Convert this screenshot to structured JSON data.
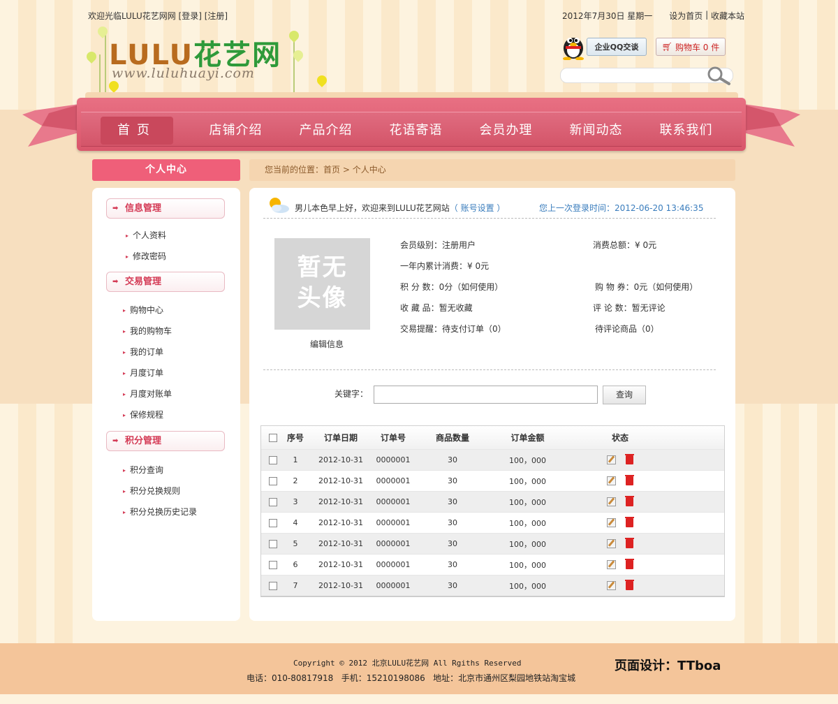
{
  "topbar": {
    "welcome": "欢迎光临LULU花艺网网 [登录] [注册]",
    "date": "2012年7月30日 星期一",
    "set_home": "设为首页",
    "sep": " | ",
    "favorite": "收藏本站"
  },
  "logo": {
    "brand_latin": "LULU",
    "brand_cn": "花艺网",
    "url": "www.luluhuayi.com"
  },
  "header": {
    "qq_label": "企业QQ交谈",
    "cart_label": "购物车 0 件",
    "search_placeholder": ""
  },
  "nav": [
    "首页",
    "店铺介绍",
    "产品介绍",
    "花语寄语",
    "会员办理",
    "新闻动态",
    "联系我们"
  ],
  "sidebar": {
    "title": "个人中心",
    "groups": [
      {
        "label": "信息管理",
        "items": [
          "个人资料",
          "修改密码"
        ]
      },
      {
        "label": "交易管理",
        "items": [
          "购物中心",
          "我的购物车",
          "我的订单",
          "月度订单",
          "月度对账单",
          "保修规程"
        ]
      },
      {
        "label": "积分管理",
        "items": [
          "积分查询",
          "积分兑换规则",
          "积分兑换历史记录"
        ]
      }
    ]
  },
  "breadcrumb": {
    "prefix": "您当前的位置：",
    "home": "首页",
    "sep": " > ",
    "current": "个人中心"
  },
  "profile": {
    "greeting": "男儿本色早上好，欢迎来到LULU花艺网站",
    "account_link": "（ 账号设置 ）",
    "last_login": "您上一次登录时间：2012-06-20 13:46:35",
    "avatar_text_1": "暂无",
    "avatar_text_2": "头像",
    "edit_info": "编辑信息",
    "member_level": "会员级别：注册用户",
    "total_spent": "消费总额：¥ 0元",
    "year_spent": "一年内累计消费：¥ 0元",
    "points": "积 分 数：0分（如何使用）",
    "coupons": "购 物 券：0元（如何使用）",
    "collections": "收 藏 品：暂无收藏",
    "reviews": "评 论 数：暂无评论",
    "trade_reminder": "交易提醒：待支付订单（0）",
    "pending_reviews": "待评论商品（0）"
  },
  "search": {
    "label": "关键字：",
    "value": "",
    "button": "查询"
  },
  "table": {
    "headers": [
      "序号",
      "订单日期",
      "订单号",
      "商品数量",
      "订单金额",
      "状态"
    ],
    "rows": [
      [
        "1",
        "2012-10-31",
        "0000001",
        "30",
        "100，000"
      ],
      [
        "2",
        "2012-10-31",
        "0000001",
        "30",
        "100，000"
      ],
      [
        "3",
        "2012-10-31",
        "0000001",
        "30",
        "100，000"
      ],
      [
        "4",
        "2012-10-31",
        "0000001",
        "30",
        "100，000"
      ],
      [
        "5",
        "2012-10-31",
        "0000001",
        "30",
        "100，000"
      ],
      [
        "6",
        "2012-10-31",
        "0000001",
        "30",
        "100，000"
      ],
      [
        "7",
        "2012-10-31",
        "0000001",
        "30",
        "100，000"
      ]
    ]
  },
  "footer": {
    "copyright": "Copyright © 2012 北京LULU花艺网 All Rgiths Reserved",
    "contact": "电话：010-80817918   手机：15210198086   地址：北京市通州区梨园地铁站淘宝城",
    "design": "页面设计：TTboa"
  },
  "colors": {
    "nav_pink": "#d9566b",
    "accent_pink": "#ef5f79",
    "link_blue": "#3a7dbd",
    "footer_tan": "#f4c59a"
  }
}
